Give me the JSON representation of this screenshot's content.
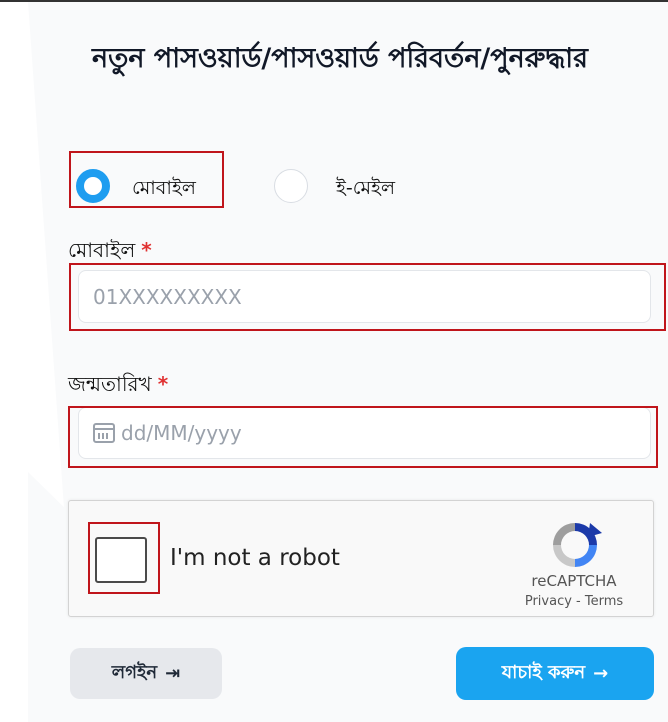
{
  "title": "নতুন পাসওয়ার্ড/পাসওয়ার্ড পরিবর্তন/পুনরুদ্ধার",
  "method": {
    "options": [
      {
        "label": "মোবাইল",
        "selected": true
      },
      {
        "label": "ই-মেইল",
        "selected": false
      }
    ]
  },
  "mobile": {
    "label": "মোবাইল",
    "required_mark": "*",
    "placeholder": "01XXXXXXXXX"
  },
  "dob": {
    "label": "জন্মতারিখ",
    "required_mark": "*",
    "placeholder": "dd/MM/yyyy"
  },
  "captcha": {
    "checkbox_label": "I'm not a robot",
    "brand": "reCAPTCHA",
    "links": "Privacy - Terms"
  },
  "buttons": {
    "login_label": "লগইন",
    "login_icon": "⇥",
    "verify_label": "যাচাই করুন",
    "verify_icon": "→"
  },
  "colors": {
    "accent": "#1aa4f0",
    "highlight": "#c0151b",
    "required": "#e03131"
  }
}
